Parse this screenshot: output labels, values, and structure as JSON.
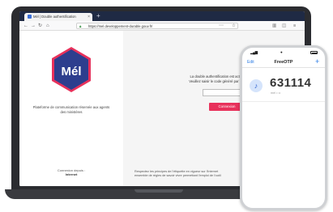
{
  "browser": {
    "tab_title": "Mél | Double authentification",
    "tab_close": "×",
    "new_tab": "+",
    "url": "https://mel.developpement-durable.gouv.fr/"
  },
  "left_panel": {
    "logo_text": "Mél",
    "caption": "Plateforme de communication réservée aux agents des ministères",
    "connection_label": "Connexion depuis :",
    "connection_value": "Internet"
  },
  "right_panel": {
    "instruction_line1": "La double authentification est activée pour votre",
    "instruction_line2": "Veuillez saisir le code généré par votre téléphone",
    "connect_button": "Connexion",
    "footer_line1": "Respectez les principes de l'étiquette en vigueur sur l'Internet",
    "footer_line2": "ensemble de règles de savoir vivre permettant l'emploi de l'outil"
  },
  "phone": {
    "edit": "Edit",
    "app_title": "FreeOTP",
    "add": "+",
    "otp_code": "631114",
    "otp_subtitle": "mel • ••"
  },
  "colors": {
    "accent": "#e8315b",
    "logo_blue": "#2d3e8e",
    "tabbar": "#1f2a44"
  }
}
